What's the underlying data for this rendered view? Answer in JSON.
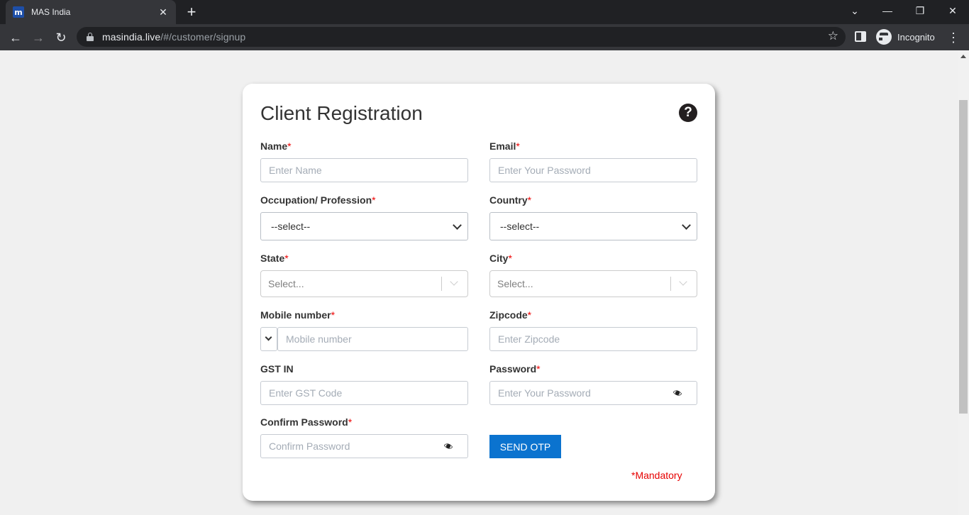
{
  "browser": {
    "tab_title": "MAS India",
    "tab_favicon_letter": "m",
    "url_host": "masindia.live",
    "url_path": "/#/customer/signup",
    "profile_label": "Incognito"
  },
  "form": {
    "title": "Client Registration",
    "required_marker": "*",
    "fields": {
      "name": {
        "label": "Name",
        "placeholder": "Enter Name"
      },
      "email": {
        "label": "Email",
        "placeholder": "Enter Your Password"
      },
      "occupation": {
        "label": "Occupation/ Profession",
        "value": "--select--"
      },
      "country": {
        "label": "Country",
        "value": "--select--"
      },
      "state": {
        "label": "State",
        "placeholder": "Select..."
      },
      "city": {
        "label": "City",
        "placeholder": "Select..."
      },
      "mobile": {
        "label": "Mobile number",
        "placeholder": "Mobile number"
      },
      "zipcode": {
        "label": "Zipcode",
        "placeholder": "Enter Zipcode"
      },
      "gst": {
        "label": "GST IN",
        "placeholder": "Enter GST Code"
      },
      "password": {
        "label": "Password",
        "placeholder": "Enter Your Password"
      },
      "confirm_password": {
        "label": "Confirm Password",
        "placeholder": "Confirm Password"
      }
    },
    "send_otp_label": "SEND OTP",
    "mandatory_note": "*Mandatory"
  },
  "colors": {
    "primary_button": "#0b73cf",
    "required": "#e00000",
    "chrome_dark": "#202124"
  },
  "icons": {
    "help": "question-circle",
    "password_toggle": "eye"
  }
}
